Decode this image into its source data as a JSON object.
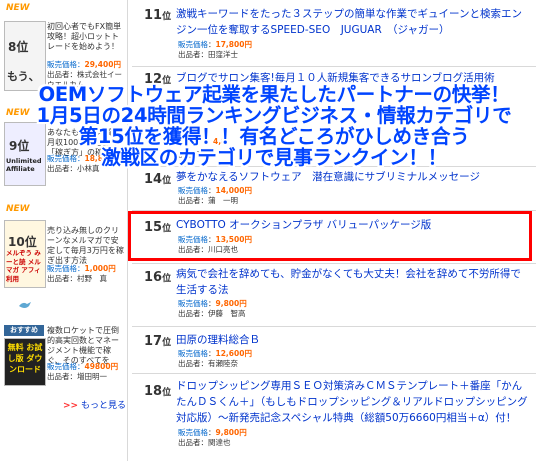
{
  "sidebar": {
    "items": [
      {
        "new_badge": "NEW",
        "rank_label": "8位",
        "thumb_text": "もう、",
        "desc": "初回心者でもFX簡単攻略！超小ロットトレードを始めよう！",
        "price_label": "販売価格",
        "price": "29,400円",
        "seller_label": "出品者",
        "seller": "株式会社イーウエルカム"
      },
      {
        "new_badge": "NEW",
        "rank_label": "9位",
        "thumb_text": "Unlimited Affiliate",
        "desc": "あなたも1日1時間で月収100万円を稼ぐ「稼ぎ方」の稼ぎ方",
        "price_label": "販売価格",
        "price": "18,8",
        "seller_label": "出品者",
        "seller": "小林真"
      },
      {
        "new_badge": "NEW",
        "rank_label": "10位",
        "thumb_text": "メルぞう みーと読 メルマガ アフィ 利用",
        "desc": "売り込み無しのクリーンなメルマガで安定して毎月3万円を稼ぎ出す方法",
        "price_label": "販売価格",
        "price": "1,000円",
        "seller_label": "出品者",
        "seller": "村野　真"
      },
      {
        "new_badge": "おすすめ",
        "rank_label": "",
        "thumb_text": "無料 お試し版 ダウンロード",
        "desc": "複数ロケットで圧倒的高実回数とマネージメント機能で稼ぐ、そのすべてを",
        "price_label": "販売価格",
        "price": "49800円",
        "seller_label": "出品者",
        "seller": "増田明一"
      }
    ],
    "more_arrow": ">>",
    "more_label": "もっと見る"
  },
  "ranking": [
    {
      "rank": "11",
      "suffix": "位",
      "title": "激戦キーワードをたった３ステップの簡単な作業でギュイーンと検索エンジン一位を奪取するSPEED-SEO　JUGUAR　（ジャガー）",
      "price_label": "販売価格",
      "price": "17,800円",
      "seller_label": "出品者",
      "seller": "田窪洋士"
    },
    {
      "rank": "12",
      "suffix": "位",
      "title": "ブログでサロン集客!毎月１０人新規集客できるサロンブログ活用術",
      "price_label": "販売価格",
      "price": "4,8",
      "seller_label": "出品者",
      "seller": ""
    },
    {
      "rank": "14",
      "suffix": "位",
      "title": "夢をかなえるソフトウェア　潜在意識にサブリミナルメッセージ",
      "price_label": "販売価格",
      "price": "14,000円",
      "seller_label": "出品者",
      "seller": "蒲　一明"
    },
    {
      "rank": "15",
      "suffix": "位",
      "title": "CYBOTTO オークションプラザ バリューパッケージ版",
      "price_label": "販売価格",
      "price": "13,500円",
      "seller_label": "出品者",
      "seller": "川口亮也"
    },
    {
      "rank": "16",
      "suffix": "位",
      "title": "病気で会社を辞めても、貯金がなくても大丈夫！会社を辞めて不労所得で生活する法",
      "price_label": "販売価格",
      "price": "9,800円",
      "seller_label": "出品者",
      "seller": "伊藤　智高"
    },
    {
      "rank": "17",
      "suffix": "位",
      "title": "田原の理料総合Ｂ",
      "price_label": "販売価格",
      "price": "12,600円",
      "seller_label": "出品者",
      "seller": "有瀬陸奈"
    },
    {
      "rank": "18",
      "suffix": "位",
      "title": "ドロップシッピング専用ＳＥＯ対策済みＣＭＳテンプレート＋番座「かんたんＤＳくん＋」（もしもドロップシッピング＆リアルドロップシッピング対応版）～新発売記念スペシャル特典（総額50万6660円相当＋α）付！",
      "price_label": "販売価格",
      "price": "9,800円",
      "seller_label": "出品者",
      "seller": "関達也"
    }
  ],
  "overlay": {
    "line1": "OEMソフトウェア起業を果たしたパートナーの快挙！",
    "line2": "1月5日の24時間ランキングビジネス・情報カテゴリで",
    "line3": "第15位を獲得！！有名どころがひしめき合う",
    "line4": "激戦区のカテゴリで見事ランクイン！！"
  },
  "colors": {
    "overlay_text": "#0044ff",
    "highlight": "#ff0000",
    "link": "#0033cc",
    "price": "#ff6600",
    "badge": "#ff9900"
  }
}
